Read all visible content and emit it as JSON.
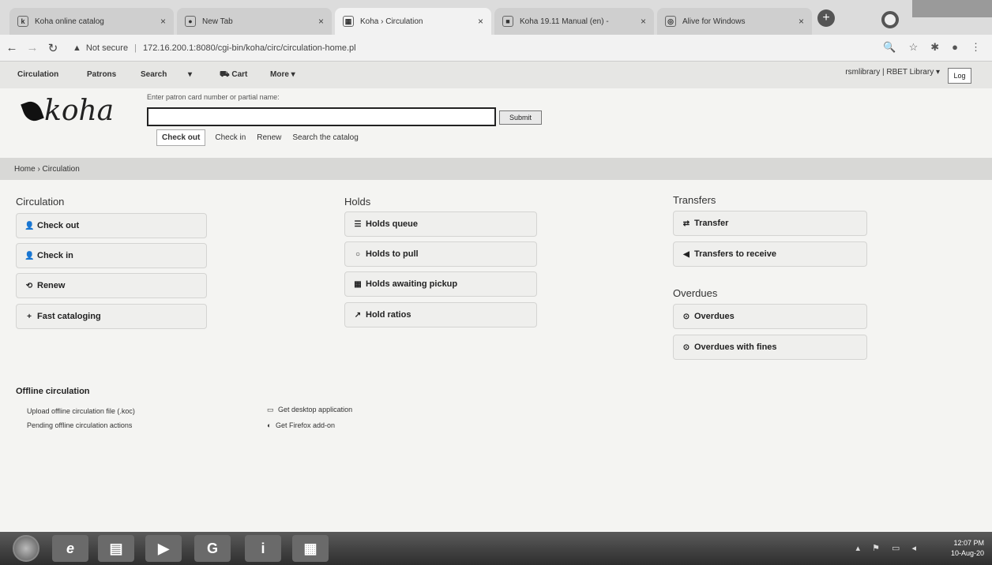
{
  "browser": {
    "tabs": [
      {
        "label": "Koha online catalog",
        "icon": "koha-tab-icon",
        "glyph": "k"
      },
      {
        "label": "New Tab",
        "icon": "chrome-tab-icon",
        "glyph": "●"
      },
      {
        "label": "Koha › Circulation",
        "icon": "koha-grid-icon",
        "glyph": "▦"
      },
      {
        "label": "Koha 19.11 Manual (en) -",
        "icon": "manual-tab-icon",
        "glyph": "■"
      },
      {
        "label": "Alive for Windows",
        "icon": "alive-tab-icon",
        "glyph": "◎"
      }
    ],
    "tab_close": "×",
    "new_tab": "+",
    "security_label": "Not secure",
    "url": "172.16.200.1:8080/cgi-bin/koha/circ/circulation-home.pl"
  },
  "koha": {
    "nav": {
      "circulation": "Circulation",
      "patrons": "Patrons",
      "search": "Search",
      "dropdown": "▾",
      "cart": "Cart",
      "more": "More ▾",
      "user_info": "rsmlibrary | RBET Library ▾"
    },
    "logout": "Log",
    "logo_text": "koha",
    "search": {
      "hint": "Enter patron card number or partial name:",
      "value": "",
      "submit": "Submit"
    },
    "search_tabs": [
      "Check out",
      "Check in",
      "Renew",
      "Search the catalog"
    ],
    "breadcrumb": "Home › Circulation"
  },
  "main": {
    "circulation": {
      "title": "Circulation",
      "items": [
        {
          "label": "Check out",
          "glyph": "👤"
        },
        {
          "label": "Check in",
          "glyph": "👤"
        },
        {
          "label": "Renew",
          "glyph": "⟲"
        },
        {
          "label": "Fast cataloging",
          "glyph": "+"
        }
      ]
    },
    "holds": {
      "title": "Holds",
      "items": [
        {
          "label": "Holds queue",
          "glyph": "☰"
        },
        {
          "label": "Holds to pull",
          "glyph": "○"
        },
        {
          "label": "Holds awaiting pickup",
          "glyph": "▦"
        },
        {
          "label": "Hold ratios",
          "glyph": "↗"
        }
      ]
    },
    "transfers": {
      "title": "Transfers",
      "items": [
        {
          "label": "Transfer",
          "glyph": "⇄"
        },
        {
          "label": "Transfers to receive",
          "glyph": "◀"
        }
      ]
    },
    "overdues": {
      "title": "Overdues",
      "items": [
        {
          "label": "Overdues",
          "glyph": "⊙"
        },
        {
          "label": "Overdues with fines",
          "glyph": "⊙"
        }
      ]
    },
    "offline": {
      "title": "Offline circulation",
      "upload": "Upload offline circulation file (.koc)",
      "pending": "Pending offline circulation actions",
      "desktop": "Get desktop application",
      "firefox": "Get Firefox add-on"
    }
  },
  "taskbar": {
    "clock_time": "12:07 PM",
    "clock_date": "10-Aug-20"
  }
}
